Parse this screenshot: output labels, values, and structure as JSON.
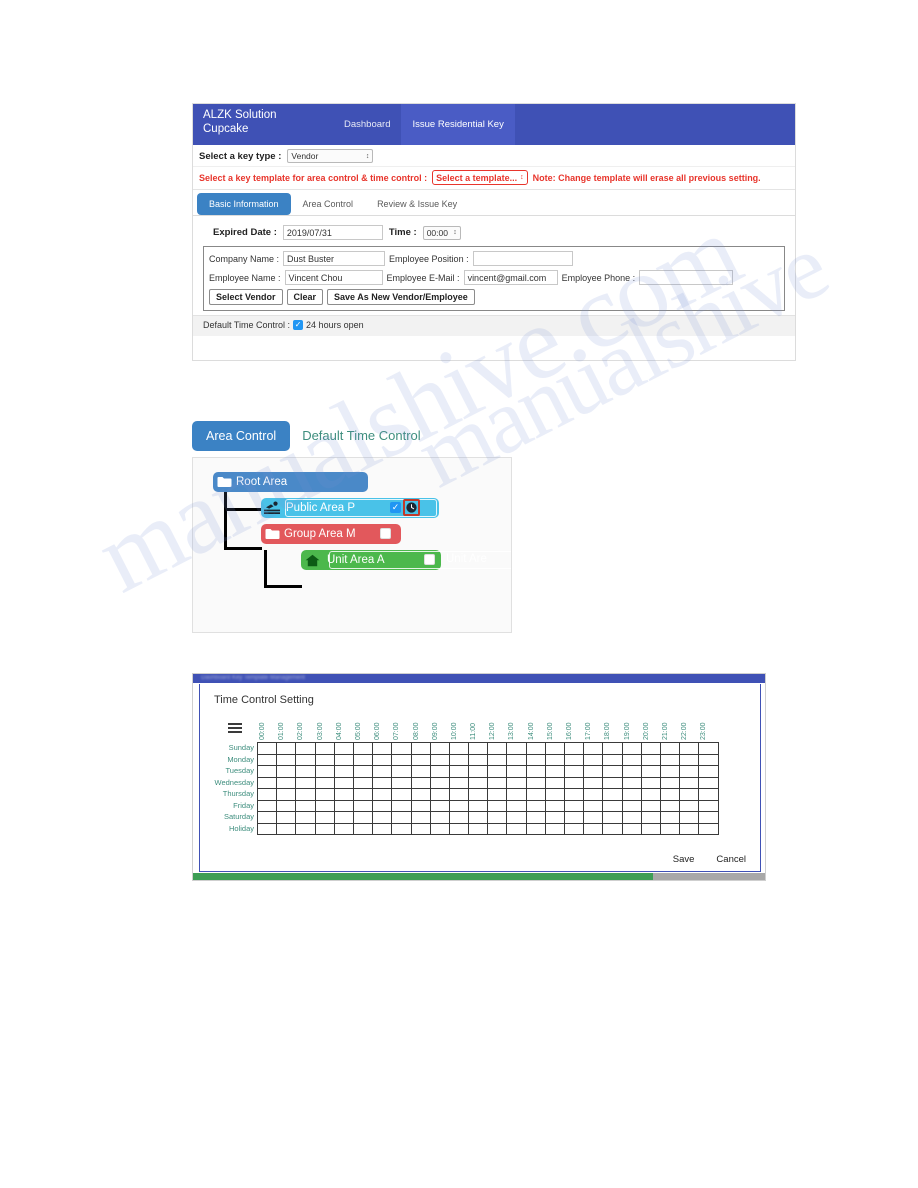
{
  "app": {
    "brand_line1": "ALZK Solution",
    "brand_line2": "Cupcake",
    "nav": [
      {
        "label": "Dashboard",
        "active": false
      },
      {
        "label": "Issue Residential Key",
        "active": true
      }
    ]
  },
  "key_type": {
    "label": "Select a key type :",
    "value": "Vendor",
    "spinner": "↕"
  },
  "template": {
    "label": "Select a key template for area control & time control :",
    "value": "Select a template...",
    "spinner": "↕",
    "note": "Note: Change template will erase all previous setting.",
    "color": "#e8352c"
  },
  "tabs": [
    {
      "label": "Basic Information",
      "active": true
    },
    {
      "label": "Area Control",
      "active": false
    },
    {
      "label": "Review & Issue Key",
      "active": false
    }
  ],
  "basic": {
    "expired_label": "Expired Date :",
    "expired_value": "2019/07/31",
    "time_label": "Time :",
    "time_value": "00:00",
    "time_spinner": "↕",
    "company_label": "Company Name :",
    "company_value": "Dust Buster",
    "position_label": "Employee Position :",
    "position_value": "",
    "empname_label": "Employee Name :",
    "empname_value": "Vincent Chou",
    "email_label": "Employee E-Mail :",
    "email_value": "vincent@gmail.com",
    "phone_label": "Employee Phone :",
    "phone_value": "",
    "btn_select_vendor": "Select Vendor",
    "btn_clear": "Clear",
    "btn_save_as_new": "Save As New Vendor/Employee",
    "default_time_label": "Default Time Control :",
    "default_time_option": "24 hours open",
    "default_time_checked": true,
    "check_glyph": "✓"
  },
  "area_control": {
    "tab_active": "Area Control",
    "tab_inactive": "Default Time Control",
    "tab_inactive_color": "#3e8e7e",
    "nodes": [
      {
        "name": "Root Area",
        "icon": "folder-icon",
        "color": "#4a89c8",
        "checkbox": "none"
      },
      {
        "name": "Public Area P",
        "icon": "swimmer-icon",
        "color": "#49c2e8",
        "checkbox": "checked",
        "clock_button": true
      },
      {
        "name": "Group Area M",
        "icon": "folder-icon",
        "color": "#e2585c",
        "checkbox": "unchecked"
      },
      {
        "name": "Unit Area A",
        "icon": "home-icon",
        "color": "#4cb84c",
        "checkbox": "unchecked",
        "overflow_label": "Unit Are"
      }
    ],
    "check_glyph": "✓",
    "clock_glyph": "🕒"
  },
  "time_modal": {
    "title": "Time Control Setting",
    "menu_icon": "hamburger-icon",
    "hours": [
      "00:00",
      "01:00",
      "02:00",
      "03:00",
      "04:00",
      "05:00",
      "06:00",
      "07:00",
      "08:00",
      "09:00",
      "10:00",
      "11:00",
      "12:00",
      "13:00",
      "14:00",
      "15:00",
      "16:00",
      "17:00",
      "18:00",
      "19:00",
      "20:00",
      "21:00",
      "22:00",
      "23:00"
    ],
    "days": [
      "Sunday",
      "Monday",
      "Tuesday",
      "Wednesday",
      "Thursday",
      "Friday",
      "Saturday",
      "Holiday"
    ],
    "selected_cells": [],
    "save_label": "Save",
    "cancel_label": "Cancel",
    "label_color": "#3e8e7e",
    "background_topbar_text": "Dashboard    Key Template Management"
  },
  "watermark": {
    "line1": "manualshive.com",
    "line2": "manualshive"
  }
}
